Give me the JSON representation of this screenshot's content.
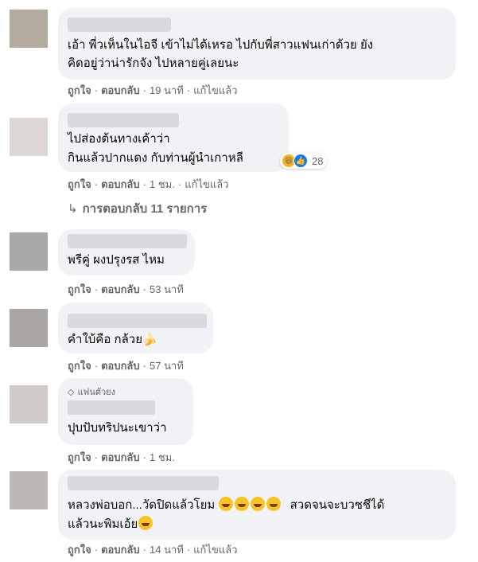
{
  "actions": {
    "like": "ถูกใจ",
    "reply": "ตอบกลับ",
    "sep": "·",
    "edited": "แก้ไขแล้ว"
  },
  "comments": [
    {
      "line1": "เอ้า พี่วเห็นในไอจี เข้าไม่ได้เหรอ ไปกับพี่สาวแฟนเก่าด้วย ยัง",
      "line2": "คิดอยู่ว่าน่ารักจัง ไปหลายคู่เลยนะ",
      "time": "19 นาที"
    },
    {
      "line1": "ไปส่องต้นทางเค้าว่า",
      "line2": "กินแล้วปากแดง กับท่านผู้นำเกาหลี",
      "reaction_count": "28",
      "time": "1 ชม."
    },
    {
      "line1": "พรีคู่ ผงปรุงรส ไหม",
      "time": "53 นาที"
    },
    {
      "line1": "คำใบ้คือ กล้วย",
      "time": "57 นาที"
    },
    {
      "badge": "แฟนตัวยง",
      "line1": "ปุบปับทริปนะเขาว่า",
      "time": "1 ชม."
    },
    {
      "line1": "หลวงพ่อบอก...วัดปิดแล้วโยม",
      "line1b": "สวดจนจะบวชชีได้",
      "line2": "แล้วนะพิมเอ้ย",
      "time": "14 นาที"
    }
  ],
  "replies_toggle": "การตอบกลับ 11 รายการ",
  "colors": {
    "bubble": "#f0f2f5",
    "meta": "#65676b",
    "text": "#050505"
  }
}
